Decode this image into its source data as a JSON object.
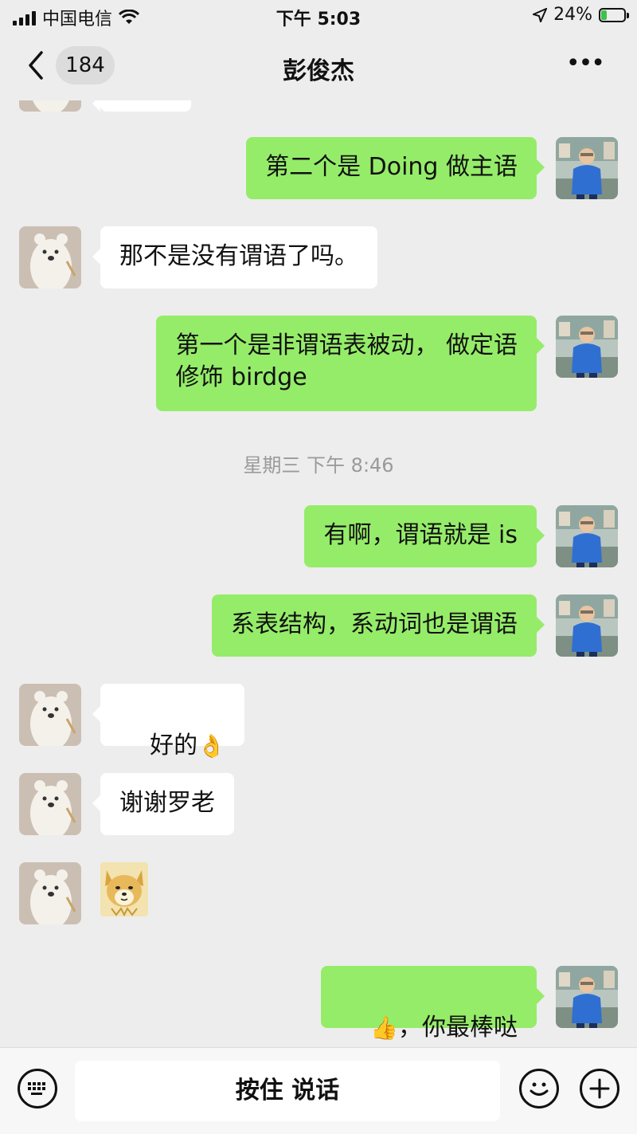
{
  "status_bar": {
    "carrier": "中国电信",
    "time": "下午 5:03",
    "battery": "24%",
    "battery_level": 0.24
  },
  "header": {
    "back_count": "184",
    "title": "彭俊杰",
    "more_label": "•••"
  },
  "messages": [
    {
      "side": "right",
      "text": "第二个是 Doing 做主语"
    },
    {
      "side": "left",
      "text": "那不是没有谓语了吗。"
    },
    {
      "side": "right",
      "text": "第一个是非谓语表被动， 做定语\n修饰 birdge"
    },
    {
      "type": "timestamp",
      "text": "星期三 下午 8:46"
    },
    {
      "side": "right",
      "text": "有啊，谓语就是 is"
    },
    {
      "side": "right",
      "text": "系表结构，系动词也是谓语"
    },
    {
      "side": "left",
      "text": "好的",
      "emoji": "👌"
    },
    {
      "side": "left",
      "text": "谢谢罗老"
    },
    {
      "side": "left",
      "type": "sticker",
      "sticker": "doge-sticker"
    },
    {
      "side": "right",
      "emoji": "👍",
      "text": "，你最棒哒"
    }
  ],
  "input_bar": {
    "hold_to_talk": "按住 说话",
    "keyboard_icon": "keyboard-icon",
    "emoji_icon": "smiley-icon",
    "add_icon": "plus-icon"
  },
  "colors": {
    "background": "#ededed",
    "self_bubble": "#95ec69",
    "other_bubble": "#ffffff"
  }
}
